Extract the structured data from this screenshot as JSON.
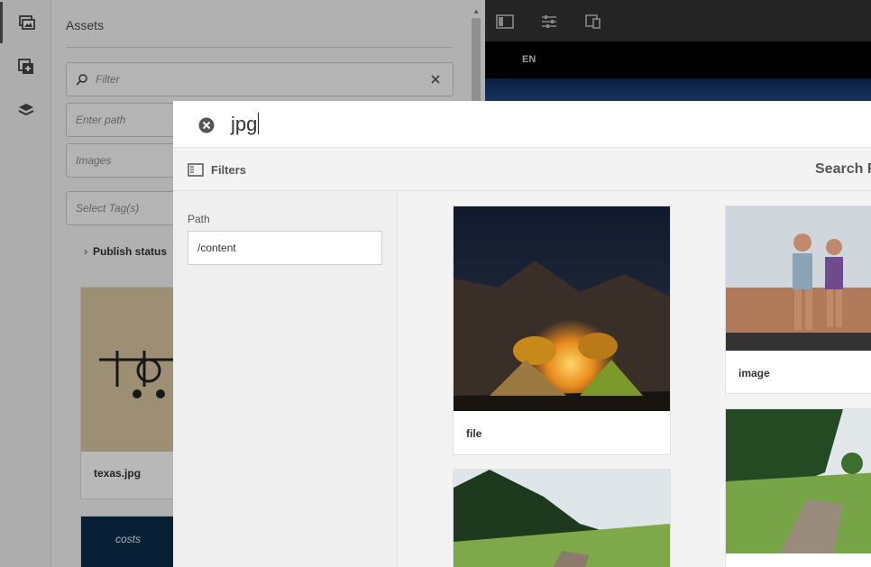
{
  "rail": {
    "icons": [
      "assets-finder-icon",
      "components-icon",
      "content-tree-icon"
    ]
  },
  "assets_panel": {
    "title": "Assets",
    "filter_placeholder": "Filter",
    "path_placeholder": "Enter path",
    "type_placeholder": "Images",
    "tags_placeholder": "Select Tag(s)",
    "publish_status": "Publish status",
    "cards": [
      {
        "label": "texas.jpg"
      },
      {
        "label": "costs"
      }
    ]
  },
  "editor": {
    "language": "EN"
  },
  "search": {
    "query": "jpg",
    "filters_label": "Filters",
    "results_label": "Search R",
    "path_label": "Path",
    "path_value": "/content",
    "results": [
      {
        "label": "file"
      },
      {
        "label": "image"
      },
      {
        "label": ""
      },
      {
        "label": ""
      }
    ]
  }
}
